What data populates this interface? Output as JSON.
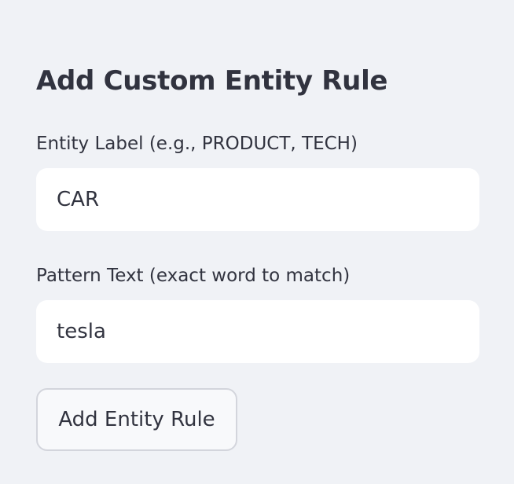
{
  "form": {
    "title": "Add Custom Entity Rule",
    "entity_label": {
      "label": "Entity Label (e.g., PRODUCT, TECH)",
      "value": "CAR"
    },
    "pattern_text": {
      "label": "Pattern Text (exact word to match)",
      "value": "tesla"
    },
    "submit_label": "Add Entity Rule"
  },
  "colors": {
    "background": "#f0f2f6",
    "text": "#31333f",
    "input_background": "#ffffff",
    "button_border": "#d3d5dc"
  }
}
